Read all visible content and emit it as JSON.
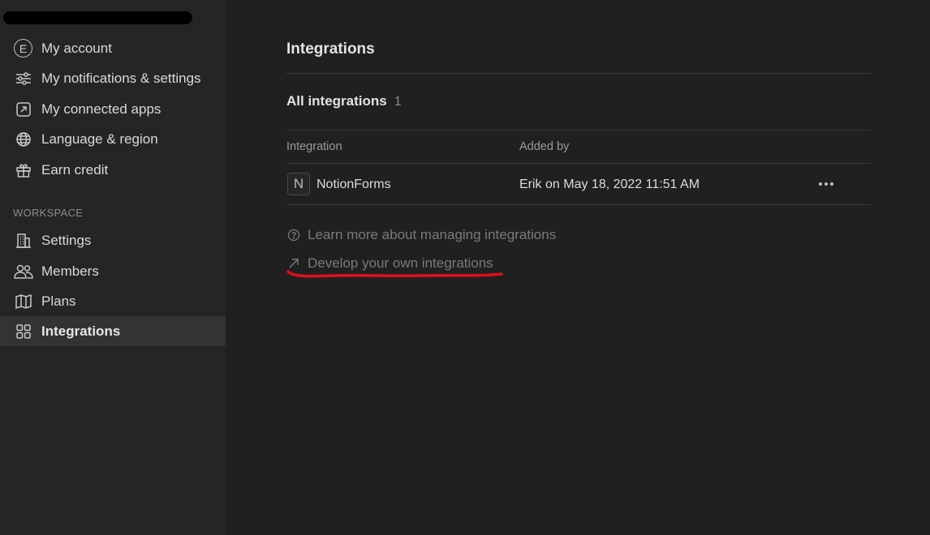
{
  "sidebar": {
    "account_items": [
      {
        "label": "My account",
        "icon": "avatar-e-icon",
        "avatar_letter": "E"
      },
      {
        "label": "My notifications & settings",
        "icon": "sliders-icon"
      },
      {
        "label": "My connected apps",
        "icon": "external-link-box-icon"
      },
      {
        "label": "Language & region",
        "icon": "globe-icon"
      },
      {
        "label": "Earn credit",
        "icon": "gift-icon"
      }
    ],
    "workspace_label": "WORKSPACE",
    "workspace_items": [
      {
        "label": "Settings",
        "icon": "building-icon"
      },
      {
        "label": "Members",
        "icon": "people-icon"
      },
      {
        "label": "Plans",
        "icon": "map-icon"
      },
      {
        "label": "Integrations",
        "icon": "grid-icon",
        "active": true
      }
    ]
  },
  "main": {
    "title": "Integrations",
    "all_integrations_label": "All integrations",
    "all_integrations_count": "1",
    "table": {
      "columns": [
        "Integration",
        "Added by"
      ],
      "rows": [
        {
          "icon_letter": "N",
          "name": "NotionForms",
          "added_by": "Erik on May 18, 2022 11:51 AM"
        }
      ]
    },
    "links": {
      "learn_more": "Learn more about managing integrations",
      "develop": "Develop your own integrations"
    }
  },
  "colors": {
    "sidebar_bg": "#252525",
    "main_bg": "#202020",
    "active_item_bg": "#333333",
    "annotation_red": "#e0101a"
  }
}
